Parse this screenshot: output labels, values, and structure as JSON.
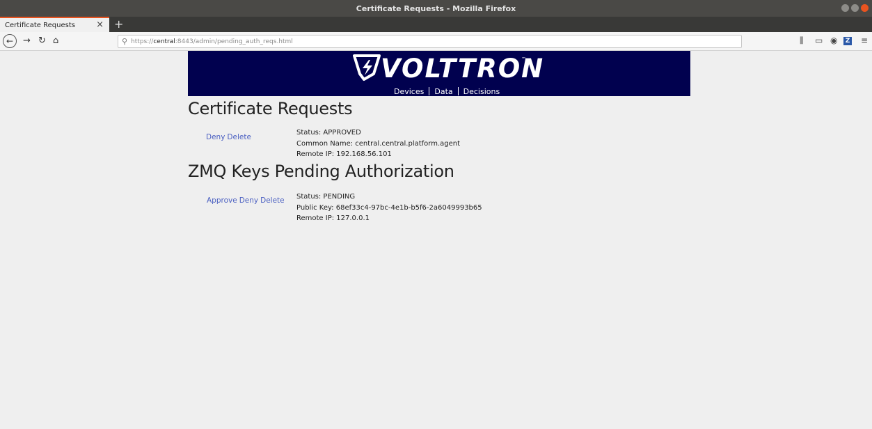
{
  "window": {
    "title": "Certificate Requests - Mozilla Firefox"
  },
  "tabs": [
    {
      "label": "Certificate Requests",
      "close": "×"
    }
  ],
  "new_tab": "+",
  "nav": {
    "back": "←",
    "forward": "→",
    "reload": "↻",
    "home": "⌂",
    "url_scheme": "https://",
    "url_host": "central",
    "url_path": ":8443/admin/pending_auth_reqs.html"
  },
  "toolbar": {
    "library": "⫼",
    "sidebar": "▭",
    "account": "◉",
    "zotero": "Z",
    "menu": "≡"
  },
  "banner": {
    "brand": "VOLTTRON",
    "tm": "™",
    "tagline": [
      "Devices",
      "Data",
      "Decisions"
    ]
  },
  "certificate_requests": {
    "heading": "Certificate Requests",
    "items": [
      {
        "actions": [
          "Deny",
          "Delete"
        ],
        "status": "Status: APPROVED",
        "common_name": "Common Name: central.central.platform.agent",
        "remote_ip": "Remote IP: 192.168.56.101"
      }
    ]
  },
  "zmq_keys": {
    "heading": "ZMQ Keys Pending Authorization",
    "items": [
      {
        "actions": [
          "Approve",
          "Deny",
          "Delete"
        ],
        "status": "Status: PENDING",
        "public_key": "Public Key: 68ef33c4-97bc-4e1b-b5f6-2a6049993b65",
        "remote_ip": "Remote IP: 127.0.0.1"
      }
    ]
  },
  "colors": {
    "banner_bg": "#01014f",
    "link": "#4a5fc1",
    "accent": "#e95420",
    "page_bg": "#efefef"
  },
  "icons": [
    "back-icon",
    "forward-icon",
    "reload-icon",
    "home-icon",
    "search-icon",
    "library-icon",
    "sidebar-icon",
    "account-icon",
    "zotero-icon",
    "menu-icon",
    "volttron-logo-icon"
  ]
}
